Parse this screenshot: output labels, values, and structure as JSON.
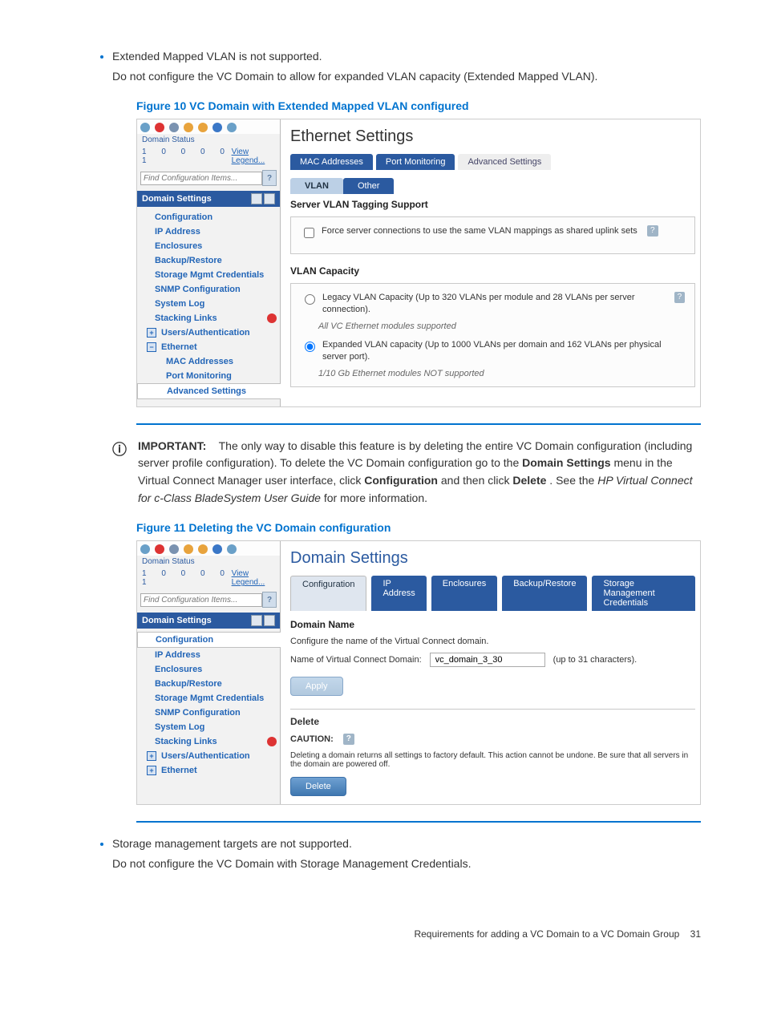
{
  "bullet1": "Extended Mapped VLAN is not supported.",
  "bullet1_sub": "Do not configure the VC Domain to allow for expanded VLAN capacity (Extended Mapped VLAN).",
  "fig10_caption": "Figure 10 VC Domain with Extended Mapped VLAN configured",
  "sidebar": {
    "domain_status_label": "Domain Status",
    "status_nums": "1  0  0  0  0  1",
    "view_legend": "View Legend...",
    "find_placeholder": "Find Configuration Items...",
    "domain_settings": "Domain Settings",
    "items": {
      "configuration": "Configuration",
      "ip": "IP Address",
      "enclosures": "Enclosures",
      "backup": "Backup/Restore",
      "storage": "Storage Mgmt Credentials",
      "snmp": "SNMP Configuration",
      "syslog": "System Log",
      "stacking": "Stacking Links",
      "users": "Users/Authentication",
      "ethernet": "Ethernet",
      "mac": "MAC Addresses",
      "port": "Port Monitoring",
      "adv": "Advanced Settings"
    }
  },
  "fig10": {
    "title": "Ethernet Settings",
    "tabs": {
      "mac": "MAC Addresses",
      "port": "Port Monitoring",
      "adv": "Advanced Settings"
    },
    "subtabs": {
      "vlan": "VLAN",
      "other": "Other"
    },
    "svr_title": "Server VLAN Tagging Support",
    "force": "Force server connections to use the same VLAN mappings as shared uplink sets",
    "cap_title": "VLAN Capacity",
    "legacy": "Legacy VLAN Capacity (Up to 320 VLANs per module and 28 VLANs per server connection).",
    "legacy_note": "All VC Ethernet modules supported",
    "expanded": "Expanded VLAN capacity (Up to 1000 VLANs per domain and 162 VLANs per physical server port).",
    "expanded_note": "1/10 Gb Ethernet modules NOT supported"
  },
  "important": {
    "lead": "IMPORTANT:",
    "body_1": "The only way to disable this feature is by deleting the entire VC Domain configuration (including server profile configuration). To delete the VC Domain configuration go to the ",
    "bold_domain": "Domain Settings",
    "body_2": " menu in the Virtual Connect Manager user interface, click ",
    "bold_conf": "Configuration",
    "body_3": " and then click ",
    "bold_delete": "Delete",
    "body_4": ". See the ",
    "italic": "HP Virtual Connect for c-Class BladeSystem User Guide",
    "body_5": " for more information."
  },
  "fig11_caption": "Figure 11 Deleting the VC Domain configuration",
  "fig11": {
    "title": "Domain Settings",
    "tabs": {
      "conf": "Configuration",
      "ip": "IP Address",
      "encl": "Enclosures",
      "backup": "Backup/Restore",
      "smc": "Storage Management Credentials"
    },
    "dn_title": "Domain Name",
    "dn_desc": "Configure the name of the Virtual Connect domain.",
    "dn_label": "Name of Virtual Connect Domain:",
    "dn_value": "vc_domain_3_30",
    "dn_hint": "(up to 31 characters).",
    "apply": "Apply",
    "delete_hdr": "Delete",
    "caution": "CAUTION:",
    "caution_body": "Deleting a domain returns all settings to factory default. This action cannot be undone. Be sure that all servers in the domain are powered off.",
    "delete_btn": "Delete"
  },
  "bullet2": "Storage management targets are not supported.",
  "bullet2_sub": "Do not configure the VC Domain with Storage Management Credentials.",
  "footer": "Requirements for adding a VC Domain to a VC Domain Group",
  "page": "31"
}
